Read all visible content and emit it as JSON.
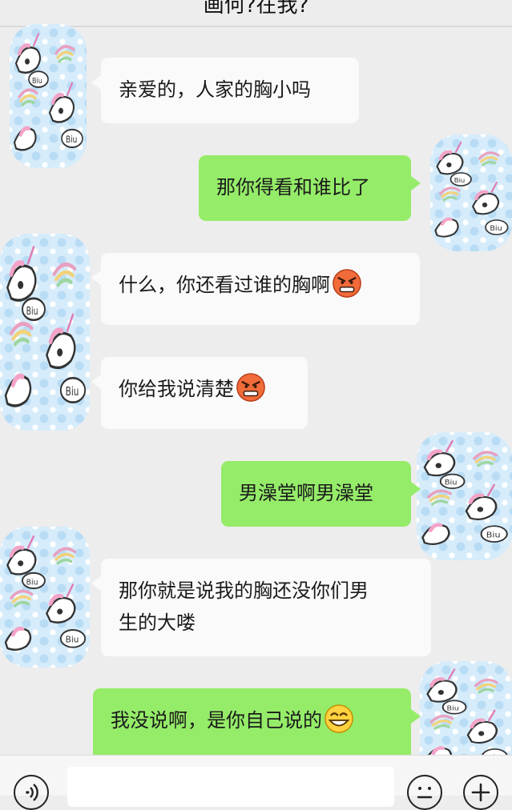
{
  "chat": {
    "title": "画何?在我?"
  },
  "messages": [
    {
      "side": "left",
      "text": "亲爱的，人家的胸小吗"
    },
    {
      "side": "right",
      "text": "那你得看和谁比了"
    },
    {
      "side": "left",
      "text": "什么，你还看过谁的胸啊",
      "emoji": "angry-face-icon"
    },
    {
      "side": "left",
      "text": "你给我说清楚",
      "emoji": "angry-face-icon"
    },
    {
      "side": "right",
      "text": "男澡堂啊男澡堂"
    },
    {
      "side": "left",
      "text_line1": "那你就是说我的胸还没你们男",
      "text_line2": "生的大喽"
    },
    {
      "side": "right",
      "text": "我没说啊，是你自己说的",
      "emoji": "grinning-face-icon"
    }
  ],
  "avatars": {
    "left": "unicorn-avatar",
    "right": "unicorn-avatar"
  },
  "input_bar": {
    "voice_icon": "voice-icon",
    "emoji_icon": "emoji-icon",
    "plus_icon": "plus-icon",
    "input_value": ""
  },
  "colors": {
    "background": "#ededed",
    "sent_bubble": "#95ec69",
    "received_bubble": "#fafafa"
  }
}
